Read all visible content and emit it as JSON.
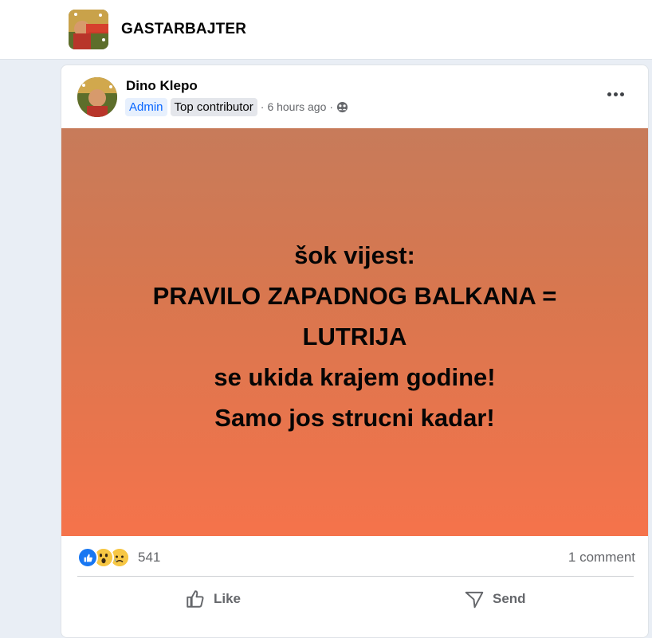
{
  "group": {
    "name": "GASTARBAJTER"
  },
  "post": {
    "author": "Dino Klepo",
    "badges": {
      "admin": "Admin",
      "top_contributor": "Top contributor"
    },
    "separator": "·",
    "time": "6 hours ago",
    "privacy_icon": "group-privacy-icon",
    "text_lines": [
      "šok vijest:",
      "PRAVILO ZAPADNOG BALKANA =",
      "LUTRIJA",
      "se ukida krajem godine!",
      "Samo jos strucni kadar!"
    ],
    "background_colors": {
      "top": "#c77b5a",
      "bottom": "#f5734b"
    },
    "reactions": {
      "icons": [
        "like-reaction-icon",
        "wow-reaction-icon",
        "sad-reaction-icon"
      ],
      "count": "541"
    },
    "comments_label": "1 comment",
    "actions": {
      "like": "Like",
      "send": "Send"
    }
  },
  "colors": {
    "accent": "#0866ff",
    "secondary_text": "#65676b",
    "page_background": "#e9eef5"
  }
}
